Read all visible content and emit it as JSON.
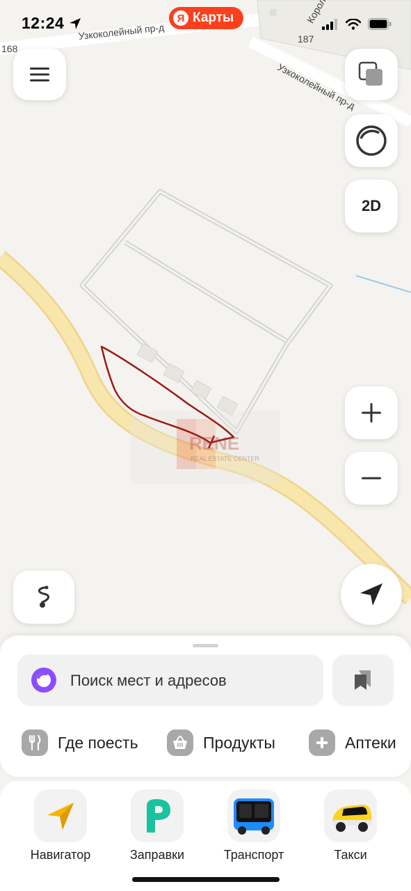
{
  "status_bar": {
    "time": "12:24"
  },
  "app_pill": {
    "logo_letter": "Я",
    "label": "Карты"
  },
  "map": {
    "streets": [
      {
        "label": "Узкоколейный пр-д"
      },
      {
        "label": "Узкоколейный пр-д"
      },
      {
        "label": "Королёвский"
      },
      {
        "label": "168"
      },
      {
        "label": "187"
      }
    ],
    "watermark": "RENE",
    "watermark_sub": "REAL ESTATE CENTER"
  },
  "controls": {
    "menu_icon": "hamburger-icon",
    "layers_icon": "layers-icon",
    "alice_icon": "alice-icon",
    "mode_label": "2D",
    "zoom_in_icon": "plus-icon",
    "zoom_out_icon": "minus-icon",
    "route_icon": "route-icon",
    "locate_icon": "navigation-arrow-icon"
  },
  "bottom_sheet": {
    "search_placeholder": "Поиск мест и адресов",
    "chips": [
      {
        "label": "Где поесть",
        "icon": "fork-knife-icon"
      },
      {
        "label": "Продукты",
        "icon": "basket-icon"
      },
      {
        "label": "Аптеки",
        "icon": "plus-cross-icon"
      }
    ]
  },
  "tab_bar": {
    "items": [
      {
        "label": "Навигатор",
        "icon": "navigator-icon"
      },
      {
        "label": "Заправки",
        "icon": "fuel-p-icon"
      },
      {
        "label": "Транспорт",
        "icon": "bus-icon"
      },
      {
        "label": "Такси",
        "icon": "taxi-car-icon"
      }
    ]
  },
  "colors": {
    "map_bg": "#f4f3ef",
    "road_yellow": "#f8e3a4",
    "drawn_outline": "#9a1b12",
    "accent_red": "#fc3f1d",
    "alice_purple": "#8a4dff"
  }
}
